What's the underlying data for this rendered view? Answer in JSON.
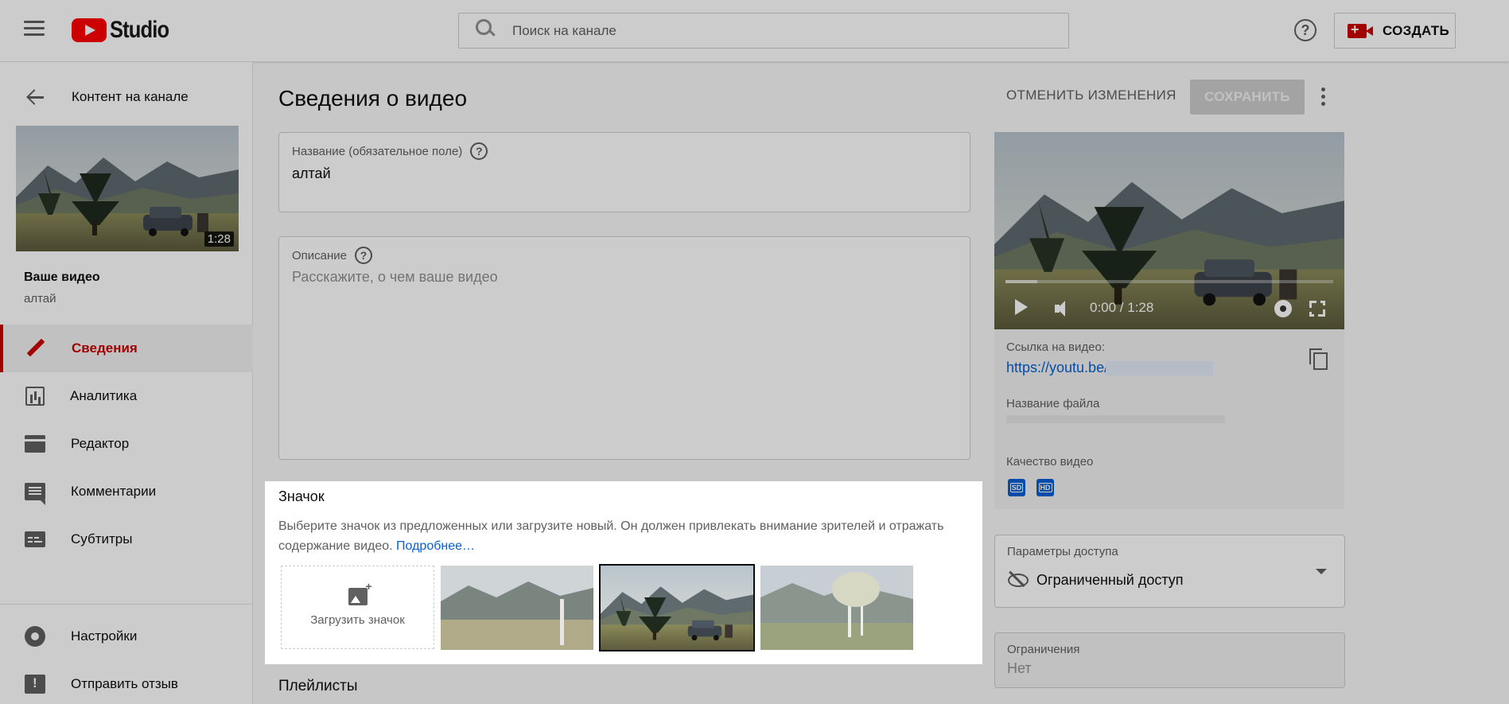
{
  "header": {
    "logo_text": "Studio",
    "search_placeholder": "Поиск на канале",
    "create_label": "СОЗДАТЬ"
  },
  "sidebar": {
    "back_label": "Контент на канале",
    "thumb_duration": "1:28",
    "your_video": "Ваше видео",
    "video_title": "алтай",
    "items": [
      {
        "label": "Сведения",
        "icon": "pencil-icon",
        "active": true
      },
      {
        "label": "Аналитика",
        "icon": "analytics-icon",
        "active": false
      },
      {
        "label": "Редактор",
        "icon": "clapperboard-icon",
        "active": false
      },
      {
        "label": "Комментарии",
        "icon": "comment-icon",
        "active": false
      },
      {
        "label": "Субтитры",
        "icon": "subtitles-icon",
        "active": false
      }
    ],
    "bottom_items": [
      {
        "label": "Настройки",
        "icon": "gear-icon"
      },
      {
        "label": "Отправить отзыв",
        "icon": "feedback-icon"
      }
    ]
  },
  "main": {
    "page_title": "Сведения о видео",
    "undo_label": "ОТМЕНИТЬ ИЗМЕНЕНИЯ",
    "save_label": "СОХРАНИТЬ",
    "title_field": {
      "label": "Название (обязательное поле)",
      "value": "алтай"
    },
    "description_field": {
      "label": "Описание",
      "placeholder": "Расскажите, о чем ваше видео"
    },
    "thumbnail": {
      "heading": "Значок",
      "description": "Выберите значок из предложенных или загрузите новый. Он должен привлекать внимание зрителей и отражать содержание видео.",
      "more_link": "Подробнее…",
      "upload_label": "Загрузить значок",
      "selected_index": 1
    },
    "playlists_heading": "Плейлисты"
  },
  "right": {
    "player_time": "0:00 / 1:28",
    "link_label": "Ссылка на видео:",
    "link_text": "https://youtu.be/",
    "filename_label": "Название файла",
    "quality_label": "Качество видео",
    "quality_badges": [
      "SD",
      "HD"
    ],
    "access_label": "Параметры доступа",
    "access_value": "Ограниченный доступ",
    "restrictions_label": "Ограничения",
    "restrictions_value": "Нет"
  },
  "colors": {
    "accent_red": "#cc0000",
    "link_blue": "#065fd4",
    "text_secondary": "#606060"
  }
}
